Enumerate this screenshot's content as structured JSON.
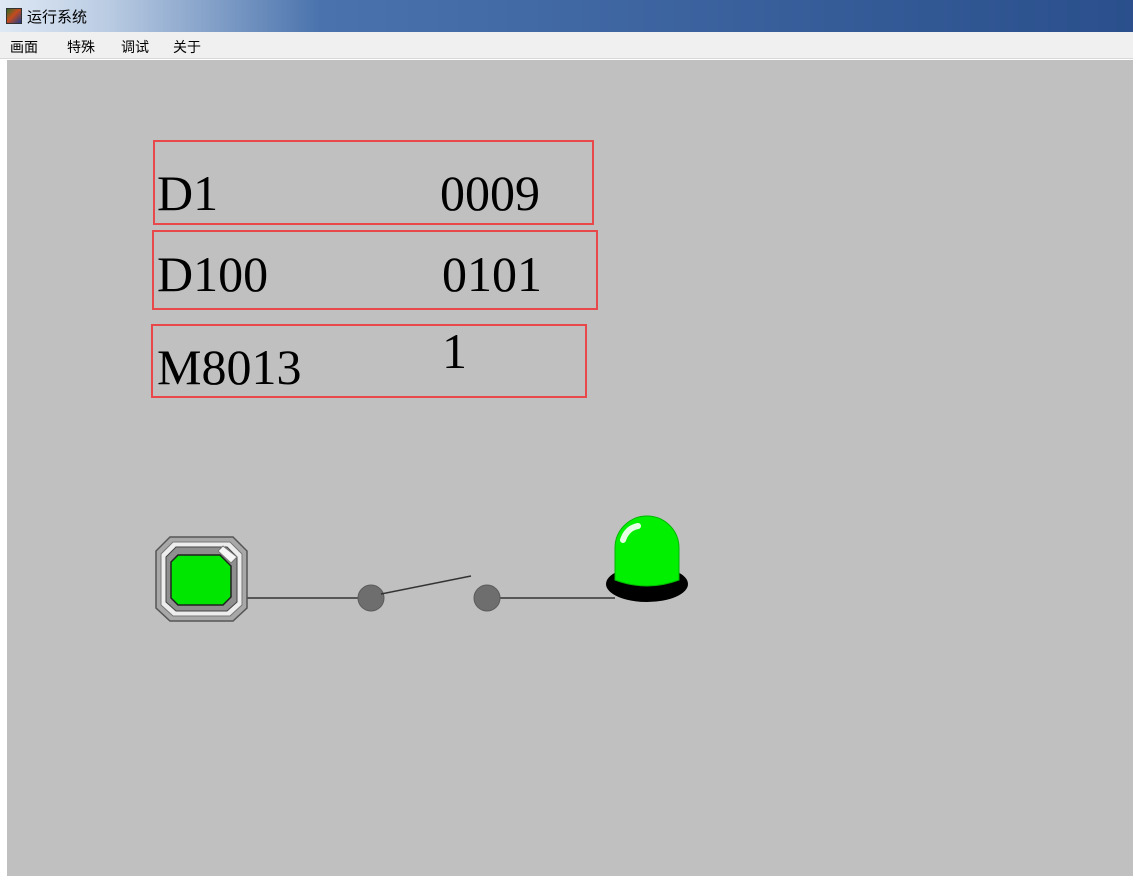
{
  "window": {
    "title": "运行系统"
  },
  "menu": {
    "items": [
      "画面",
      "特殊",
      "调试",
      "关于"
    ]
  },
  "monitors": [
    {
      "label": "D1",
      "value": "0009"
    },
    {
      "label": "D100",
      "value": "0101"
    },
    {
      "label": "M8013",
      "value": "1"
    }
  ],
  "circuit": {
    "button_color": "#00e600",
    "lamp_color": "#00f000",
    "lamp_state": "on",
    "contact_state": "open",
    "icons": [
      "pushbutton-icon",
      "switch-contact-icon",
      "indicator-lamp-icon"
    ]
  }
}
